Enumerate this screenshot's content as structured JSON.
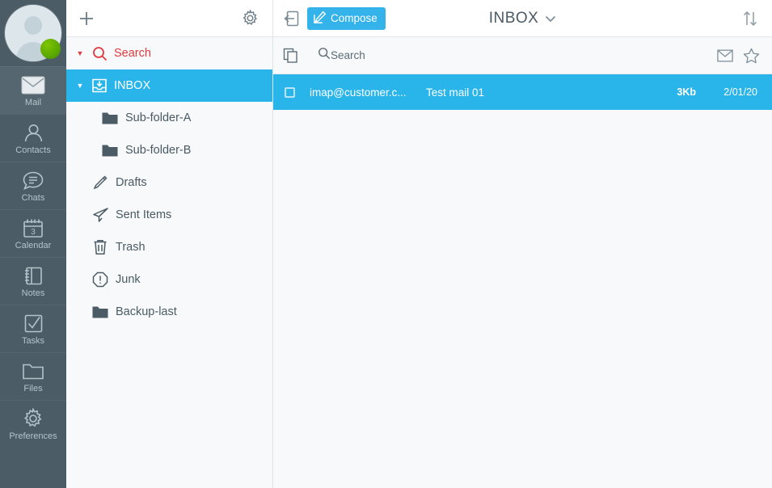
{
  "rail": {
    "avatar_alt": "user-avatar",
    "status": "online",
    "items": [
      {
        "label": "Mail",
        "icon": "mail-icon",
        "active": true
      },
      {
        "label": "Contacts",
        "icon": "contacts-icon",
        "active": false
      },
      {
        "label": "Chats",
        "icon": "chats-icon",
        "active": false
      },
      {
        "label": "Calendar",
        "icon": "calendar-icon",
        "active": false
      },
      {
        "label": "Notes",
        "icon": "notes-icon",
        "active": false
      },
      {
        "label": "Tasks",
        "icon": "tasks-icon",
        "active": false
      },
      {
        "label": "Files",
        "icon": "files-icon",
        "active": false
      },
      {
        "label": "Preferences",
        "icon": "gear-icon",
        "active": false
      }
    ],
    "calendar_day": "3"
  },
  "folders": {
    "add_icon": "plus-icon",
    "settings_icon": "gear-icon",
    "search_label": "Search",
    "items": [
      {
        "label": "INBOX",
        "icon": "inbox-icon",
        "selected": true,
        "level": 0,
        "caret": "▼"
      },
      {
        "label": "Sub-folder-A",
        "icon": "folder-icon",
        "selected": false,
        "level": 1
      },
      {
        "label": "Sub-folder-B",
        "icon": "folder-icon",
        "selected": false,
        "level": 1
      },
      {
        "label": "Drafts",
        "icon": "pencil-icon",
        "selected": false,
        "level": 0
      },
      {
        "label": "Sent Items",
        "icon": "paper-plane-icon",
        "selected": false,
        "level": 0
      },
      {
        "label": "Trash",
        "icon": "trash-icon",
        "selected": false,
        "level": 0
      },
      {
        "label": "Junk",
        "icon": "warning-icon",
        "selected": false,
        "level": 0
      },
      {
        "label": "Backup-last",
        "icon": "folder-icon",
        "selected": false,
        "level": 0
      }
    ]
  },
  "mail": {
    "collapse_icon": "collapse-panel-icon",
    "compose_label": "Compose",
    "mailbox_title": "INBOX",
    "mailbox_chevron": "chevron-down-icon",
    "sort_icon": "sort-updown-icon",
    "copy_icon": "copy-icon",
    "search_placeholder": "Search",
    "mark_read_icon": "envelope-icon",
    "flag_icon": "star-icon",
    "messages": [
      {
        "from": "imap@customer.c...",
        "subject": "Test mail 01",
        "size": "3Kb",
        "date": "2/01/20",
        "selected": true,
        "checked": false
      }
    ]
  },
  "colors": {
    "accent_blue": "#29b4ea",
    "compose_blue": "#34b3ea",
    "rail_dark": "#4c5c66",
    "rail_active": "#566670",
    "search_red": "#e0393e",
    "status_green": "#5aa800",
    "panel_bg": "#f7f9fa"
  }
}
